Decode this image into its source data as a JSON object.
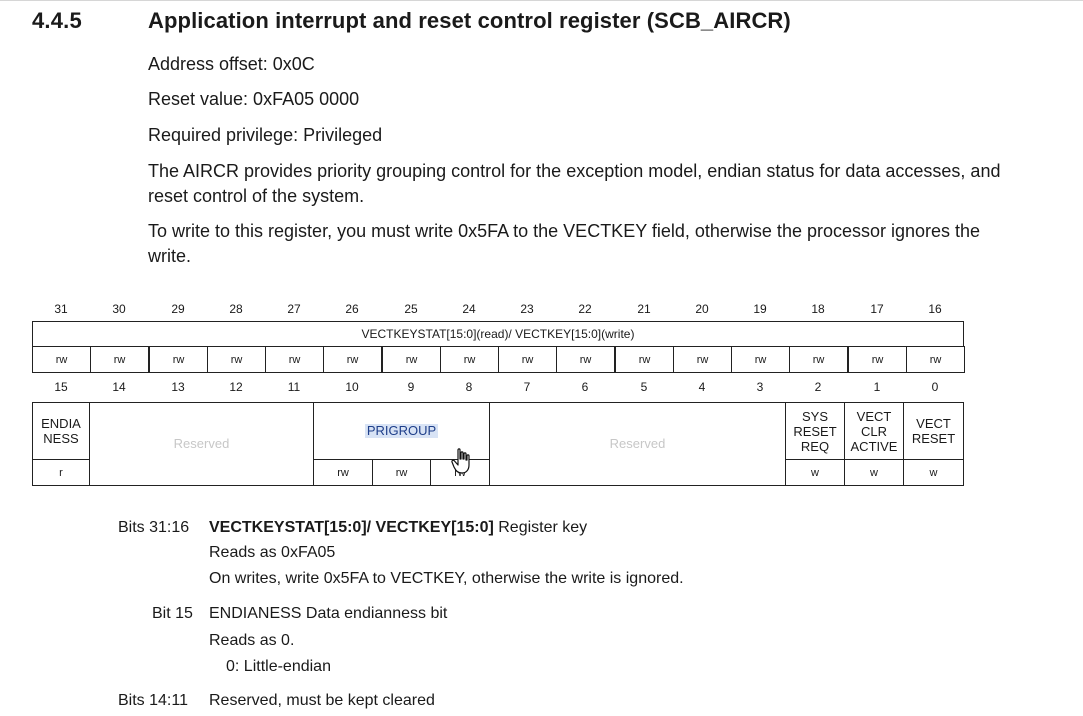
{
  "section": {
    "number": "4.4.5",
    "title": "Application interrupt and reset control register (SCB_AIRCR)"
  },
  "paragraphs": {
    "address_offset": "Address offset: 0x0C",
    "reset_value": "Reset value: 0xFA05 0000",
    "privilege": "Required privilege: Privileged",
    "description": "The AIRCR provides priority grouping control for the exception model, endian status for data accesses, and reset control of the system.",
    "write_note": "To write to this register, you must write 0x5FA to the VECTKEY field, otherwise the processor ignores the write."
  },
  "register": {
    "upper_bits": [
      "31",
      "30",
      "29",
      "28",
      "27",
      "26",
      "25",
      "24",
      "23",
      "22",
      "21",
      "20",
      "19",
      "18",
      "17",
      "16"
    ],
    "upper_field": "VECTKEYSTAT[15:0](read)/ VECTKEY[15:0](write)",
    "upper_access": [
      "rw",
      "rw",
      "rw",
      "rw",
      "rw",
      "rw",
      "rw",
      "rw",
      "rw",
      "rw",
      "rw",
      "rw",
      "rw",
      "rw",
      "rw",
      "rw"
    ],
    "lower_bits": [
      "15",
      "14",
      "13",
      "12",
      "11",
      "10",
      "9",
      "8",
      "7",
      "6",
      "5",
      "4",
      "3",
      "2",
      "1",
      "0"
    ],
    "lower_fields": {
      "endianess_line1": "ENDIA",
      "endianess_line2": "NESS",
      "reserved_1": "Reserved",
      "prigroup": "PRIGROUP",
      "reserved_2": "Reserved",
      "sysresetreq_line1": "SYS",
      "sysresetreq_line2": "RESET",
      "sysresetreq_line3": "REQ",
      "vectclractive_line1": "VECT",
      "vectclractive_line2": "CLR",
      "vectclractive_line3": "ACTIVE",
      "vectreset_line1": "VECT",
      "vectreset_line2": "RESET"
    },
    "lower_access": {
      "endianess": "r",
      "prigroup": [
        "rw",
        "rw",
        "rw"
      ],
      "sysresetreq": "w",
      "vectclractive": "w",
      "vectreset": "w"
    }
  },
  "bit_descriptions": {
    "b31_16_label": "Bits 31:16",
    "b31_16_name": "VECTKEYSTAT[15:0]/ VECTKEY[15:0]",
    "b31_16_title": " Register key",
    "b31_16_read": "Reads as 0xFA05",
    "b31_16_write": "On writes, write 0x5FA to VECTKEY, otherwise the write is ignored.",
    "b15_label": "Bit 15",
    "b15_title": "ENDIANESS Data endianness bit",
    "b15_read": "Reads as 0.",
    "b15_value": "0: Little-endian",
    "b14_11_label": "Bits 14:11",
    "b14_11_title": "Reserved, must be kept cleared"
  }
}
